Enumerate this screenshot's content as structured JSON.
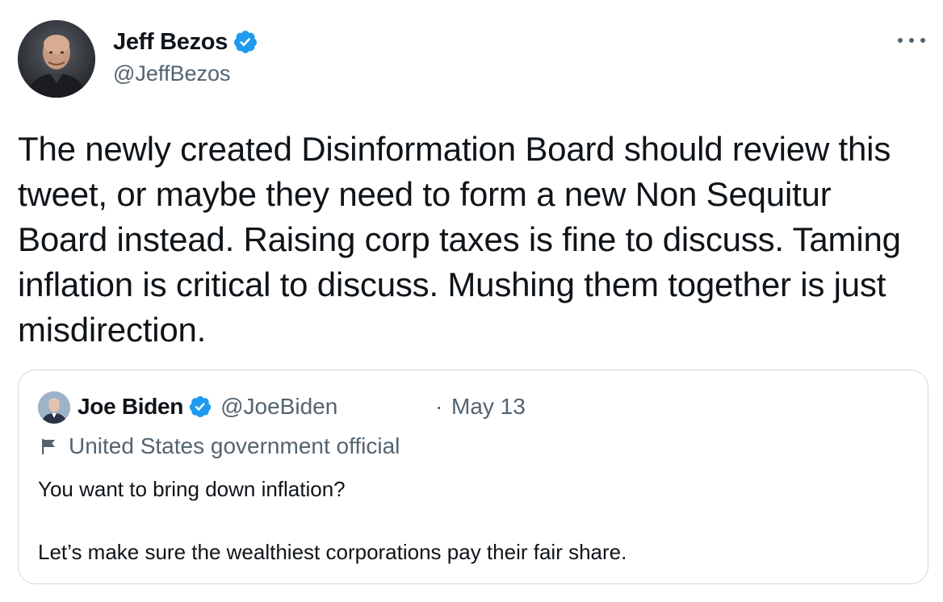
{
  "tweet": {
    "author": {
      "name": "Jeff Bezos",
      "handle": "@JeffBezos",
      "verified": true
    },
    "more_icon": "more-horizontal-icon",
    "text": "The newly created Disinformation Board should review this tweet, or maybe they need to form a new Non Sequitur Board instead. Raising corp taxes is fine to discuss. Taming inflation is critical to discuss. Mushing them together is just misdirection.",
    "quoted": {
      "author": {
        "name": "Joe Biden",
        "handle": "@JoeBiden",
        "verified": true
      },
      "separator": "·",
      "date": "May 13",
      "label": "United States government official",
      "label_icon": "flag-icon",
      "text_line1": "You want to bring down inflation?",
      "text_line2": "Let’s make sure the wealthiest corporations pay their fair share."
    }
  },
  "colors": {
    "verified_blue": "#1d9bf0",
    "secondary_text": "#536471",
    "primary_text": "#0f1419",
    "border": "#cfd9de"
  }
}
